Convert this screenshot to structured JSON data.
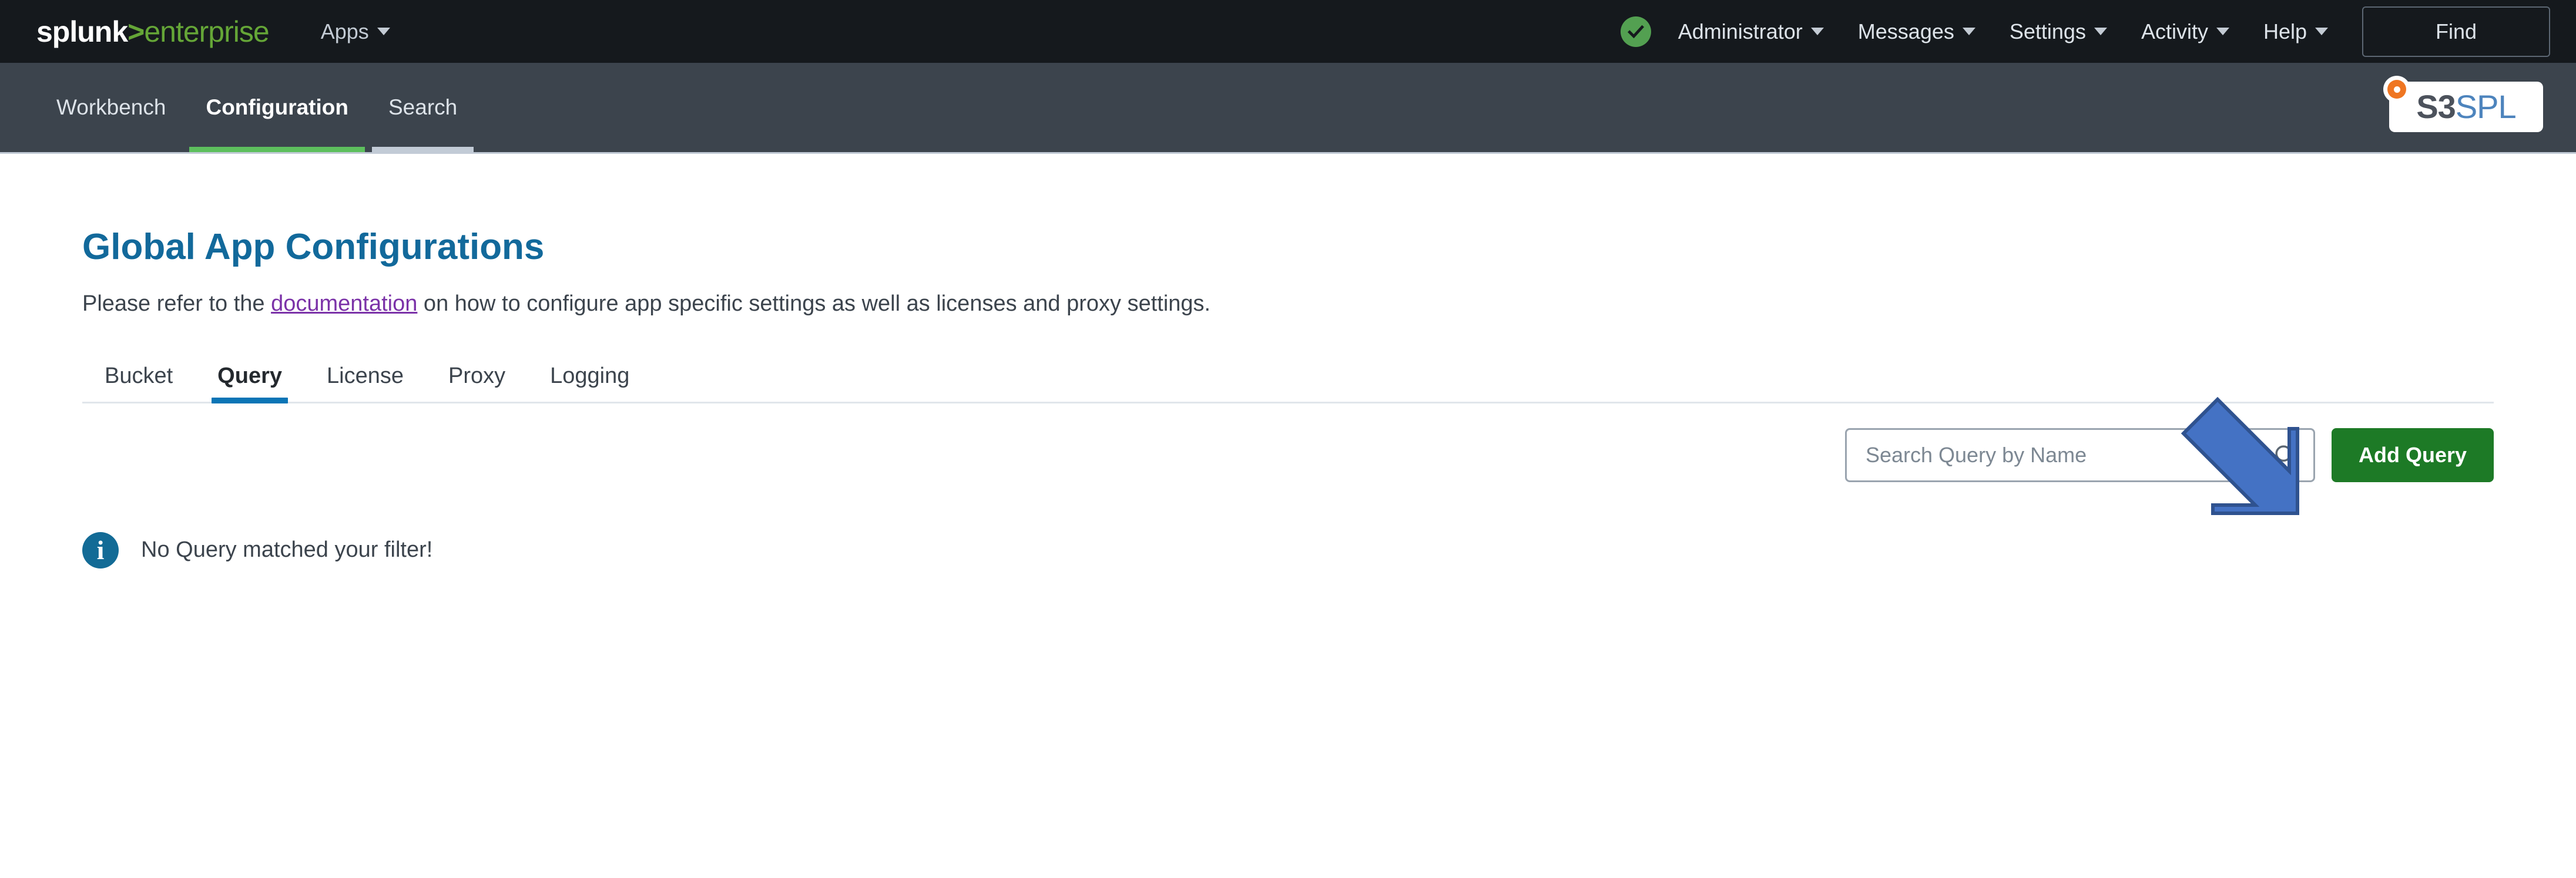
{
  "topbar": {
    "logo": {
      "splunk": "splunk",
      "gt": ">",
      "enterprise": "enterprise"
    },
    "apps_label": "Apps",
    "status_icon": "check-circle-icon",
    "menus": [
      {
        "label": "Administrator",
        "name": "administrator-menu"
      },
      {
        "label": "Messages",
        "name": "messages-menu"
      },
      {
        "label": "Settings",
        "name": "settings-menu"
      },
      {
        "label": "Activity",
        "name": "activity-menu"
      },
      {
        "label": "Help",
        "name": "help-menu"
      }
    ],
    "find_label": "Find"
  },
  "appnav": {
    "tabs": [
      {
        "label": "Workbench",
        "state": "default"
      },
      {
        "label": "Configuration",
        "state": "active"
      },
      {
        "label": "Search",
        "state": "hovered"
      }
    ],
    "app_logo": {
      "mark": "S3",
      "text": "SPL",
      "dot_color": "#ef7622"
    }
  },
  "page": {
    "title": "Global App Configurations",
    "desc_before": "Please refer to the ",
    "desc_link": "documentation",
    "desc_after": " on how to configure app specific settings as well as licenses and proxy settings."
  },
  "section_tabs": [
    {
      "label": "Bucket",
      "active": false
    },
    {
      "label": "Query",
      "active": true
    },
    {
      "label": "License",
      "active": false
    },
    {
      "label": "Proxy",
      "active": false
    },
    {
      "label": "Logging",
      "active": false
    }
  ],
  "toolbar": {
    "search_placeholder": "Search Query by Name",
    "search_value": "",
    "add_label": "Add Query"
  },
  "empty_state": {
    "icon": "info-circle-icon",
    "glyph": "i",
    "message": "No Query matched your filter!"
  },
  "annotation": {
    "type": "arrow",
    "direction": "down-right",
    "fill": "#4472c4",
    "stroke": "#2f528f",
    "points_to": "add-query-button"
  },
  "colors": {
    "topbar_bg": "#15191d",
    "appnav_bg": "#3c444d",
    "accent_green": "#65a637",
    "title_blue": "#12699b",
    "tab_active_blue": "#0b75b6",
    "add_button_green": "#1d7a26",
    "link_purple": "#7b32a8",
    "info_blue": "#136b96"
  }
}
